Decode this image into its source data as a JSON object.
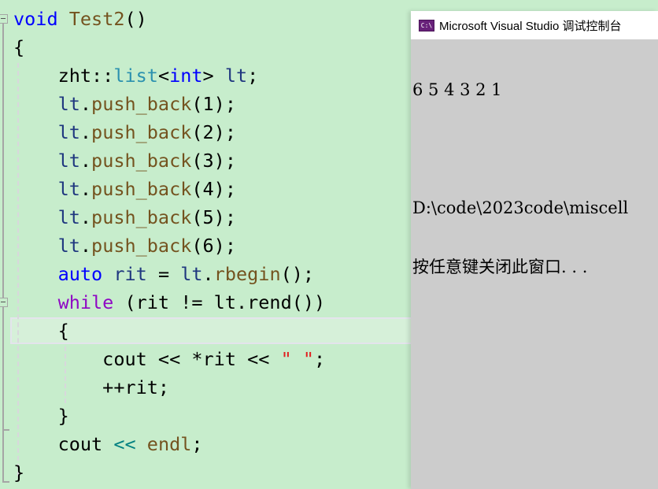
{
  "editor": {
    "partial_top_line": "",
    "lines": [
      {
        "tokens": [
          {
            "t": "void",
            "c": "kw"
          },
          {
            "t": " ",
            "c": "plain"
          },
          {
            "t": "Test2",
            "c": "fn"
          },
          {
            "t": "()",
            "c": "plain"
          }
        ]
      },
      {
        "tokens": [
          {
            "t": "{",
            "c": "plain"
          }
        ]
      },
      {
        "tokens": [
          {
            "t": "    zht::",
            "c": "plain"
          },
          {
            "t": "list",
            "c": "ty"
          },
          {
            "t": "<",
            "c": "plain"
          },
          {
            "t": "int",
            "c": "kw"
          },
          {
            "t": "> ",
            "c": "plain"
          },
          {
            "t": "lt",
            "c": "va"
          },
          {
            "t": ";",
            "c": "plain"
          }
        ]
      },
      {
        "tokens": [
          {
            "t": "    ",
            "c": "plain"
          },
          {
            "t": "lt",
            "c": "va"
          },
          {
            "t": ".",
            "c": "plain"
          },
          {
            "t": "push_back",
            "c": "fn"
          },
          {
            "t": "(1);",
            "c": "plain"
          }
        ]
      },
      {
        "tokens": [
          {
            "t": "    ",
            "c": "plain"
          },
          {
            "t": "lt",
            "c": "va"
          },
          {
            "t": ".",
            "c": "plain"
          },
          {
            "t": "push_back",
            "c": "fn"
          },
          {
            "t": "(2);",
            "c": "plain"
          }
        ]
      },
      {
        "tokens": [
          {
            "t": "    ",
            "c": "plain"
          },
          {
            "t": "lt",
            "c": "va"
          },
          {
            "t": ".",
            "c": "plain"
          },
          {
            "t": "push_back",
            "c": "fn"
          },
          {
            "t": "(3);",
            "c": "plain"
          }
        ]
      },
      {
        "tokens": [
          {
            "t": "    ",
            "c": "plain"
          },
          {
            "t": "lt",
            "c": "va"
          },
          {
            "t": ".",
            "c": "plain"
          },
          {
            "t": "push_back",
            "c": "fn"
          },
          {
            "t": "(4);",
            "c": "plain"
          }
        ]
      },
      {
        "tokens": [
          {
            "t": "    ",
            "c": "plain"
          },
          {
            "t": "lt",
            "c": "va"
          },
          {
            "t": ".",
            "c": "plain"
          },
          {
            "t": "push_back",
            "c": "fn"
          },
          {
            "t": "(5);",
            "c": "plain"
          }
        ]
      },
      {
        "tokens": [
          {
            "t": "    ",
            "c": "plain"
          },
          {
            "t": "lt",
            "c": "va"
          },
          {
            "t": ".",
            "c": "plain"
          },
          {
            "t": "push_back",
            "c": "fn"
          },
          {
            "t": "(6);",
            "c": "plain"
          }
        ]
      },
      {
        "tokens": [
          {
            "t": "    ",
            "c": "plain"
          },
          {
            "t": "auto",
            "c": "kw"
          },
          {
            "t": " ",
            "c": "plain"
          },
          {
            "t": "rit",
            "c": "va"
          },
          {
            "t": " = ",
            "c": "plain"
          },
          {
            "t": "lt",
            "c": "va"
          },
          {
            "t": ".",
            "c": "plain"
          },
          {
            "t": "rbegin",
            "c": "fn"
          },
          {
            "t": "();",
            "c": "plain"
          }
        ]
      },
      {
        "tokens": [
          {
            "t": "    ",
            "c": "plain"
          },
          {
            "t": "while",
            "c": "kw2"
          },
          {
            "t": " (rit != lt.rend())",
            "c": "plain"
          }
        ]
      },
      {
        "tokens": [
          {
            "t": "    {",
            "c": "plain"
          }
        ]
      },
      {
        "tokens": [
          {
            "t": "        cout << *rit << ",
            "c": "plain"
          },
          {
            "t": "\" \"",
            "c": "st"
          },
          {
            "t": ";",
            "c": "plain"
          }
        ]
      },
      {
        "tokens": [
          {
            "t": "        ++rit;",
            "c": "plain"
          }
        ]
      },
      {
        "tokens": [
          {
            "t": "    }",
            "c": "plain"
          }
        ]
      },
      {
        "tokens": [
          {
            "t": "    cout ",
            "c": "plain"
          },
          {
            "t": "<<",
            "c": "op"
          },
          {
            "t": " ",
            "c": "plain"
          },
          {
            "t": "endl",
            "c": "fn"
          },
          {
            "t": ";",
            "c": "plain"
          }
        ]
      },
      {
        "tokens": [
          {
            "t": "}",
            "c": "plain"
          }
        ]
      }
    ]
  },
  "console": {
    "icon_label": "C:\\",
    "title": "Microsoft Visual Studio 调试控制台",
    "output_lines": [
      "6 5 4 3 2 1",
      "",
      "D:\\code\\2023code\\miscell",
      "按任意键关闭此窗口. . ."
    ]
  },
  "colors": {
    "editor_background": "#c7edcc",
    "keyword": "#0000ff",
    "control_keyword": "#8f08c4",
    "type": "#2b91af",
    "function": "#74531f",
    "variable": "#1f377f",
    "string": "#e21f1f",
    "operator": "#008080",
    "console_background": "#cccccc",
    "console_icon": "#68217a"
  }
}
